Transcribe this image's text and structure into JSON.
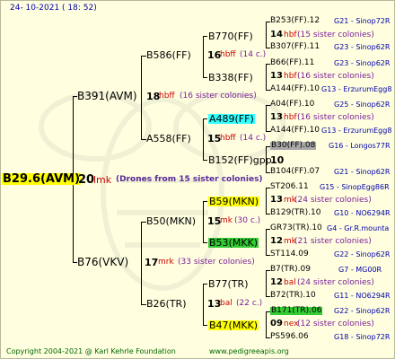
{
  "header": {
    "date": "24- 10-2021 ( 18: 52)"
  },
  "footer": {
    "copyright": "Copyright 2004-2021 @ Karl Kehrle Foundation",
    "site": "www.pedigreeapis.org"
  },
  "colors": {
    "yellow": "#ffff00",
    "cyan": "#33ffff",
    "green": "#33cc33",
    "gray": "#a8a8a8",
    "bg": "#ffffe0"
  },
  "root": {
    "name": "B29.6(AVM)",
    "num": "20",
    "code": "lmk",
    "note": "(Drones from 15 sister colonies)"
  },
  "gen1": {
    "b391": {
      "name": "B391(AVM)",
      "num": "18",
      "code": "hbff",
      "note": "(16 sister colonies)"
    },
    "b76": {
      "name": "B76(VKV)",
      "num": "17",
      "code": "mrk",
      "note": "(33 sister colonies)"
    }
  },
  "gen2": {
    "b586": {
      "name": "B586(FF)",
      "num": "16",
      "code": "hbff",
      "note": "(14 c.)"
    },
    "a558": {
      "name": "A558(FF)",
      "num": "15",
      "code": "hbff",
      "note": "(14 c.)"
    },
    "b50": {
      "name": "B50(MKN)",
      "num": "15",
      "code": "mk",
      "note": "(30 c.)"
    },
    "b26": {
      "name": "B26(TR)",
      "num": "13",
      "code": "bal",
      "note": "(22 c.)"
    }
  },
  "gen3": {
    "b770": {
      "name": "B770(FF)"
    },
    "b338": {
      "name": "B338(FF)"
    },
    "a489": {
      "name": "A489(FF)"
    },
    "b152": {
      "name": "B152(FF)gpp",
      "num": "10"
    },
    "b59": {
      "name": "B59(MKN)",
      "num": "13",
      "code": "mk",
      "note": "(24 sister colonies)"
    },
    "b53": {
      "name": "B53(MKK)",
      "num": "12",
      "code": "mk",
      "note": "(21 sister colonies)"
    },
    "b77": {
      "name": "B77(TR)",
      "num": "12",
      "code": "bal",
      "note": "(24 sister colonies)"
    },
    "b47": {
      "name": "B47(MKK)",
      "num": "09",
      "code": "nex",
      "note": "(12 sister colonies)"
    }
  },
  "gen4": {
    "b253": {
      "name": "B253(FF).12",
      "bee": "G21 - Sinop72R"
    },
    "n14": {
      "num": "14",
      "code": "hbf",
      "note": "(15 sister colonies)"
    },
    "b307": {
      "name": "B307(FF).11",
      "bee": "G23 - Sinop62R"
    },
    "b66": {
      "name": "B66(FF).11",
      "bee": "G23 - Sinop62R"
    },
    "n13a": {
      "num": "13",
      "code": "hbf",
      "note": "(16 sister colonies)"
    },
    "a144a": {
      "name": "A144(FF).10",
      "bee": "G13 - ErzurumEgg8"
    },
    "a04": {
      "name": "A04(FF).10",
      "bee": "G25 - Sinop62R"
    },
    "n13b": {
      "num": "13",
      "code": "hbf",
      "note": "(16 sister colonies)"
    },
    "a144b": {
      "name": "A144(FF).10",
      "bee": "G13 - ErzurumEgg8"
    },
    "b30": {
      "name": "B30(FF).08",
      "bee": "G16 - Longos77R"
    },
    "b104": {
      "name": "B104(FF).07",
      "bee": "G21 - Sinop62R"
    },
    "st206": {
      "name": "ST206.11",
      "bee": "G15 - SinopEgg86R"
    },
    "n13c": {
      "num": "13",
      "code": "mk",
      "note": "(24 sister colonies)"
    },
    "b129": {
      "name": "B129(TR).10",
      "bee": "G10 - NO6294R"
    },
    "gr73": {
      "name": "GR73(TR).10",
      "bee": "G4 - Gr.R.mounta"
    },
    "n12a": {
      "num": "12",
      "code": "mk",
      "note": "(21 sister colonies)"
    },
    "st114": {
      "name": "ST114.09",
      "bee": "G22 - Sinop62R"
    },
    "b7": {
      "name": "B7(TR).09",
      "bee": "G7 - MG00R"
    },
    "n12b": {
      "num": "12",
      "code": "bal",
      "note": "(24 sister colonies)"
    },
    "b72": {
      "name": "B72(TR).10",
      "bee": "G11 - NO6294R"
    },
    "b171": {
      "name": "B171(TR).06",
      "bee": "G22 - Sinop62R"
    },
    "n09": {
      "num": "09",
      "code": "nex",
      "note": "(12 sister colonies)"
    },
    "ps596": {
      "name": "PS596.06",
      "bee": "G18 - Sinop72R"
    }
  }
}
